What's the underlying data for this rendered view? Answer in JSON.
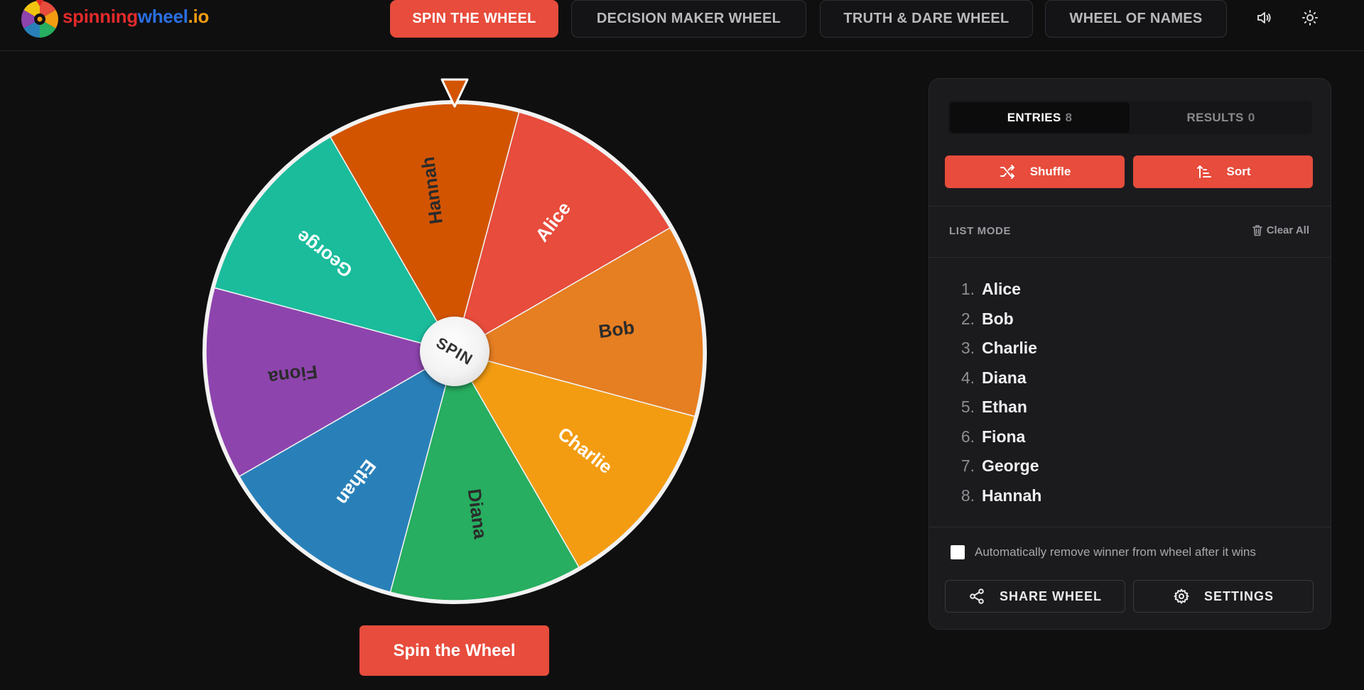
{
  "logo": {
    "part1": "spinning",
    "part2": "wheel",
    "part3": ".io"
  },
  "nav": {
    "spin": "SPIN THE WHEEL",
    "decision": "DECISION MAKER WHEEL",
    "truth": "TRUTH & DARE WHEEL",
    "names": "WHEEL OF NAMES"
  },
  "wheel": {
    "center_label": "SPIN",
    "segments": [
      {
        "label": "Alice",
        "color": "#e74c3c"
      },
      {
        "label": "Bob",
        "color": "#e67e22"
      },
      {
        "label": "Charlie",
        "color": "#f39c12"
      },
      {
        "label": "Diana",
        "color": "#27ae60"
      },
      {
        "label": "Ethan",
        "color": "#2980b9"
      },
      {
        "label": "Fiona",
        "color": "#8e44ad"
      },
      {
        "label": "George",
        "color": "#1abc9c"
      },
      {
        "label": "Hannah",
        "color": "#d35400"
      }
    ],
    "pointer_color": "#d35400",
    "spin_button": "Spin the Wheel"
  },
  "panel": {
    "tabs": {
      "entries_label": "ENTRIES",
      "entries_count": "8",
      "results_label": "RESULTS",
      "results_count": "0"
    },
    "shuffle": "Shuffle",
    "sort": "Sort",
    "list_mode": "LIST MODE",
    "clear_all": "Clear All",
    "entries": [
      {
        "num": "1.",
        "name": "Alice"
      },
      {
        "num": "2.",
        "name": "Bob"
      },
      {
        "num": "3.",
        "name": "Charlie"
      },
      {
        "num": "4.",
        "name": "Diana"
      },
      {
        "num": "5.",
        "name": "Ethan"
      },
      {
        "num": "6.",
        "name": "Fiona"
      },
      {
        "num": "7.",
        "name": "George"
      },
      {
        "num": "8.",
        "name": "Hannah"
      }
    ],
    "auto_remove": "Automatically remove winner from wheel after it wins",
    "share": "SHARE WHEEL",
    "settings": "SETTINGS"
  },
  "colors": {
    "accent": "#e74c3c",
    "background": "#0f0f10",
    "panel": "#1b1b1e"
  },
  "icons": [
    "logo-wheel-icon",
    "volume-icon",
    "sun-icon",
    "shuffle-icon",
    "sort-icon",
    "trash-icon",
    "share-icon",
    "gear-icon"
  ]
}
